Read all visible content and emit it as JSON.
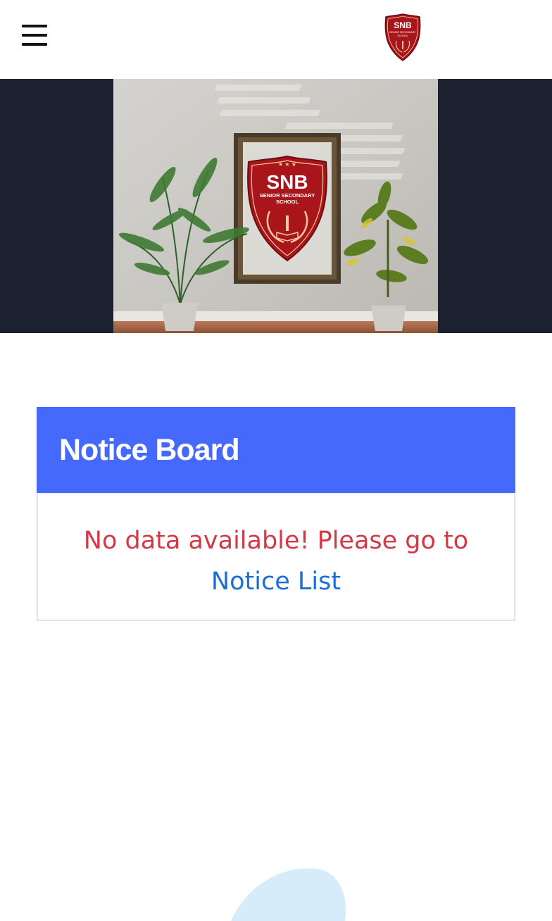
{
  "header": {
    "menu_icon": "hamburger-menu-icon",
    "logo": {
      "initials": "SNB",
      "line1": "SENIOR SECONDARY",
      "line2": "SCHOOL"
    }
  },
  "hero": {
    "badge": {
      "initials": "SNB",
      "line1": "SENIOR SECONDARY",
      "line2": "SCHOOL"
    }
  },
  "notice_board": {
    "title": "Notice Board",
    "empty_message": "No data available! Please go to",
    "link_label": "Notice List"
  },
  "colors": {
    "header_bg": "#ffffff",
    "hero_bg": "#1c2130",
    "notice_header_bg": "#4569fb",
    "empty_message": "#d53845",
    "link": "#1a6fd6",
    "logo_red": "#a8161c",
    "blob": "#d6ecfb"
  }
}
